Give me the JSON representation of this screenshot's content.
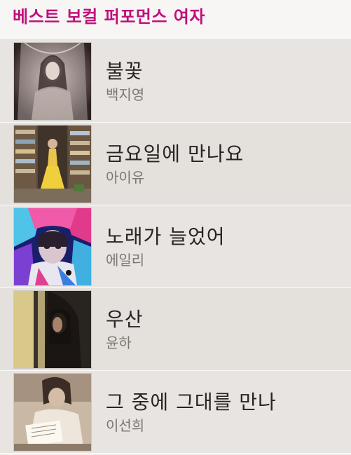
{
  "header": {
    "title": "베스트 보컬 퍼포먼스 여자"
  },
  "songs": [
    {
      "title": "불꽃",
      "artist": "백지영",
      "thumb_icon": "album-cover-veil-portrait"
    },
    {
      "title": "금요일에 만나요",
      "artist": "아이유",
      "thumb_icon": "album-cover-bookshelf-yellow-dress"
    },
    {
      "title": "노래가 늘었어",
      "artist": "에일리",
      "thumb_icon": "album-cover-colorful-fur"
    },
    {
      "title": "우산",
      "artist": "윤하",
      "thumb_icon": "album-cover-dark-window-portrait"
    },
    {
      "title": "그 중에 그대를 만나",
      "artist": "이선희",
      "thumb_icon": "album-cover-sepia-reading"
    }
  ],
  "colors": {
    "accent": "#c0107a",
    "title_text": "#262322",
    "artist_text": "#7c7672",
    "row_bg": "#e8e4e1"
  }
}
